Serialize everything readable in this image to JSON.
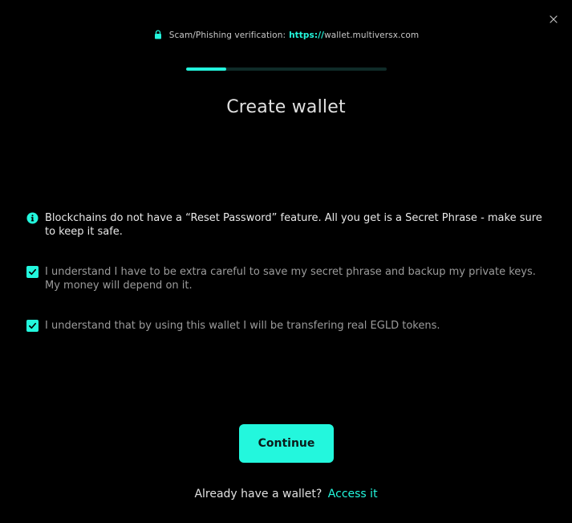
{
  "header": {
    "verification_label": "Scam/Phishing verification:",
    "url_protocol": "https://",
    "url_host": "wallet.multiversx.com",
    "close_icon": "close-icon",
    "lock_icon": "lock-icon"
  },
  "progress": {
    "fraction": 0.2
  },
  "title": "Create wallet",
  "notice": {
    "icon": "info-icon",
    "text": "Blockchains do not have a “Reset Password” feature. All you get is a Secret Phrase - make sure to keep it safe."
  },
  "checks": [
    {
      "checked": true,
      "text": "I understand I have to be extra careful to save my secret phrase and backup my private keys. My money will depend on it."
    },
    {
      "checked": true,
      "text": "I understand that by using this wallet I will be transfering real EGLD tokens."
    }
  ],
  "continue_label": "Continue",
  "footer": {
    "question": "Already have a wallet?",
    "link_label": "Access it"
  },
  "colors": {
    "accent": "#23f7dd",
    "background": "#000000",
    "track": "#0f2b28"
  }
}
